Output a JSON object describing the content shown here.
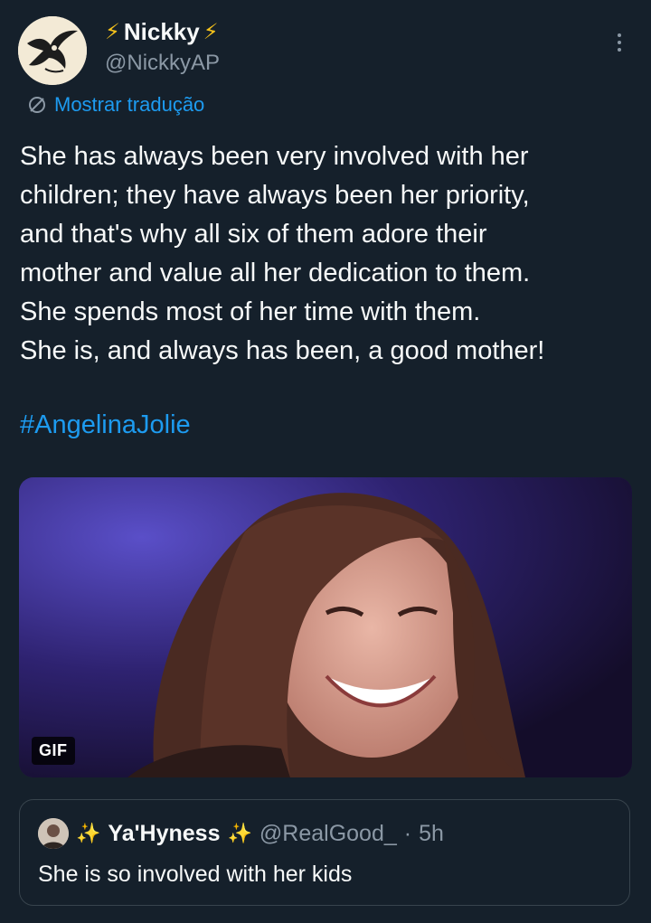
{
  "author": {
    "name": "Nickky",
    "emoji_left": "⚡",
    "emoji_right": "⚡",
    "handle": "@NickkyAP"
  },
  "translate_label": "Mostrar tradução",
  "tweet": {
    "lines": [
      "She has always been very involved with her",
      "children; they have always been her priority,",
      "and that's why all six of them adore their",
      "mother and value all her dedication to them.",
      "She spends most of her time with them.",
      "She is, and always has been, a good mother!"
    ],
    "hashtag": "#AngelinaJolie"
  },
  "media": {
    "badge": "GIF"
  },
  "quote": {
    "sparkle_left": "✨",
    "name": "Ya'Hyness",
    "sparkle_right": "✨",
    "handle": "@RealGood_",
    "separator": "·",
    "time": "5h",
    "text": "She is so involved with her kids"
  },
  "colors": {
    "background": "#15202b",
    "accent": "#1d9bf0",
    "secondary_text": "#8b98a5",
    "border": "#38444d"
  },
  "icons": [
    "more-icon",
    "translate-icon",
    "lightning-icon",
    "sparkles-icon"
  ]
}
